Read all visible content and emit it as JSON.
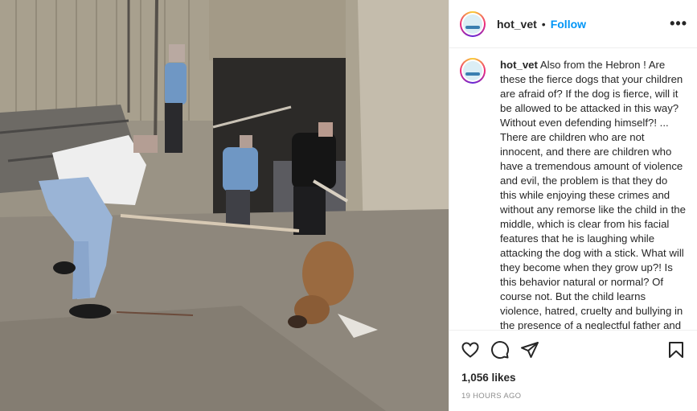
{
  "post": {
    "username": "hot_vet",
    "separator": "•",
    "follow_label": "Follow",
    "more_label": "•••",
    "caption": "Also from the Hebron ! Are these the fierce dogs that your children are afraid of? If the dog is fierce, will it be allowed to be attacked in this way? Without even defending himself?! ... There are children who are not innocent, and there are children who have a tremendous amount of violence and evil, the problem is that they do this while enjoying these crimes and without any remorse like the child in the middle, which is clear from his facial features that he is laughing while attacking the dog with a stick. What will they become when they grow up?! Is this behavior natural or normal? Of course not. But the child learns violence, hatred, cruelty and bullying in the presence of a neglectful father and mother and a",
    "likes": "1,056 likes",
    "timestamp": "19 HOURS AGO"
  },
  "icons": {
    "like": "heart-icon",
    "comment": "comment-icon",
    "share": "paper-plane-icon",
    "save": "bookmark-icon"
  },
  "colors": {
    "follow": "#0095f6",
    "text": "#262626",
    "muted": "#8e8e8e",
    "border": "#efefef"
  }
}
